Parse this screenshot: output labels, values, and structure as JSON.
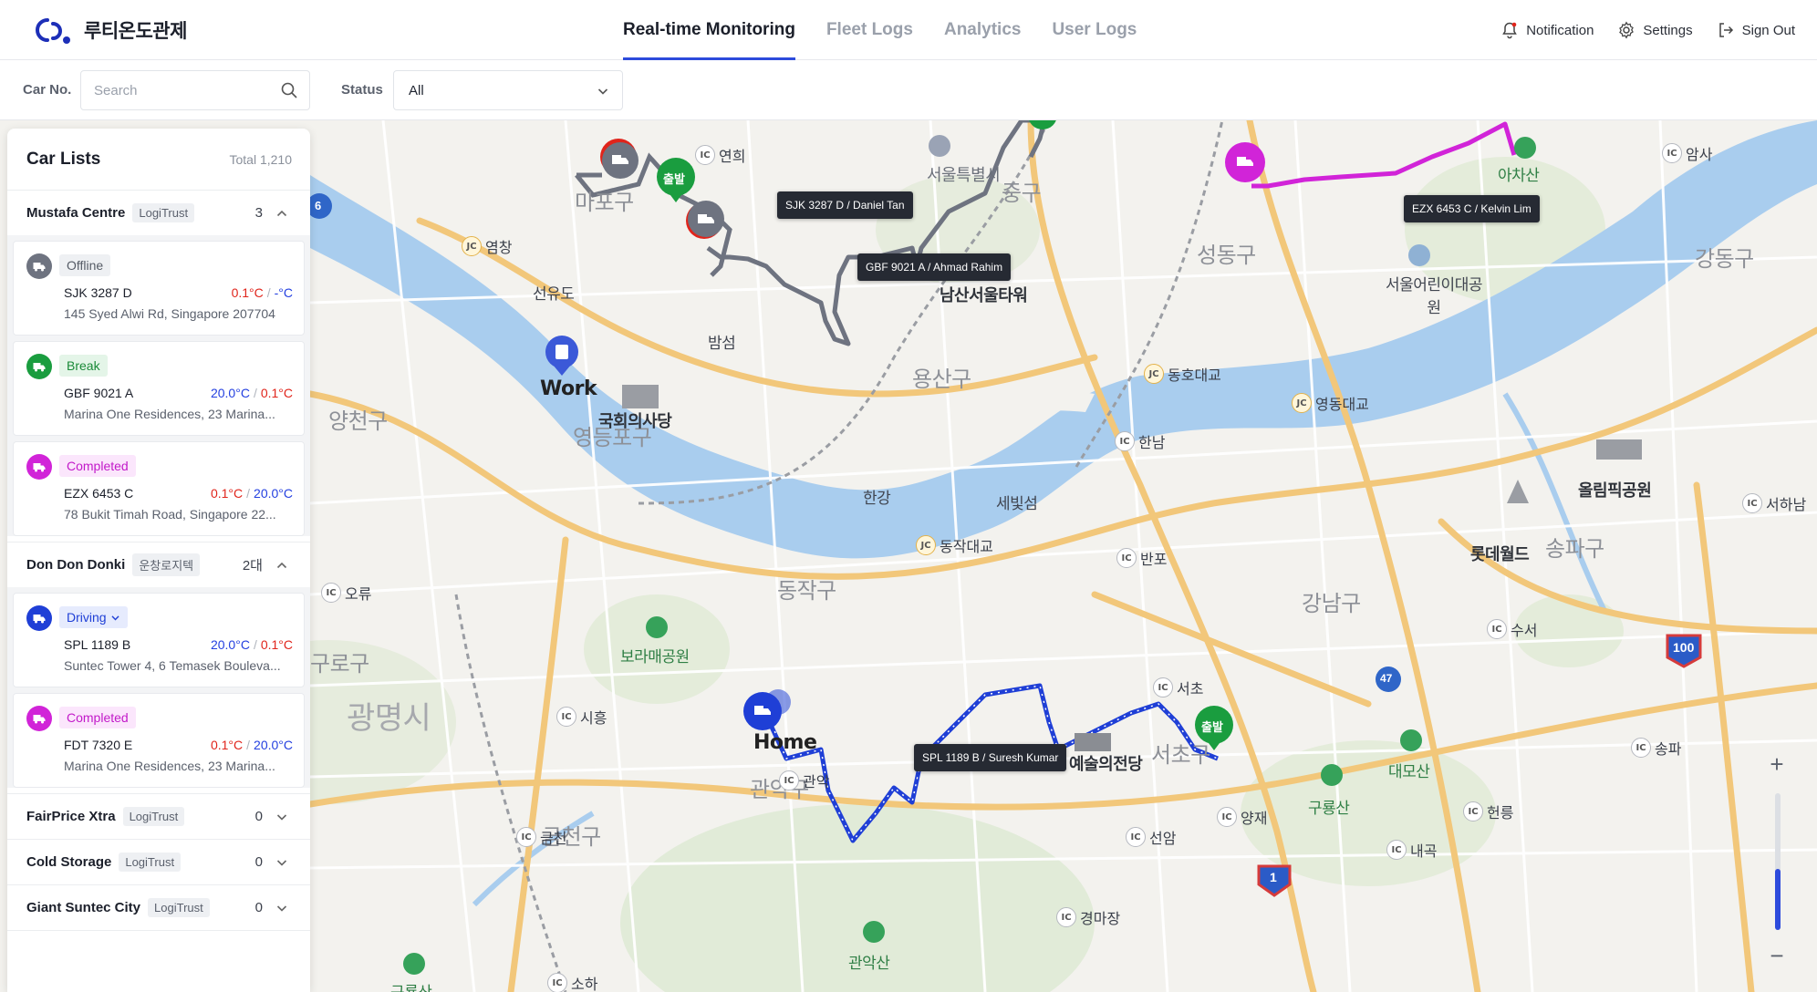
{
  "brand": {
    "name": "루티온도관제"
  },
  "nav": {
    "tabs": [
      {
        "label": "Real-time Monitoring"
      },
      {
        "label": "Fleet Logs"
      },
      {
        "label": "Analytics"
      },
      {
        "label": "User Logs"
      }
    ]
  },
  "header_actions": {
    "notification": "Notification",
    "settings": "Settings",
    "sign_out": "Sign Out"
  },
  "filters": {
    "car_no_label": "Car No.",
    "search_placeholder": "Search",
    "status_label": "Status",
    "status_value": "All"
  },
  "sidebar": {
    "title": "Car Lists",
    "total": "Total 1,210",
    "groups": [
      {
        "name": "Mustafa Centre",
        "tag": "LogiTrust",
        "count": "3",
        "cars": [
          {
            "status": "Offline",
            "plate": "SJK 3287 D",
            "temp1": "0.1°C",
            "temp2": "-°C",
            "address": "145 Syed Alwi Rd, Singapore 207704"
          },
          {
            "status": "Break",
            "plate": "GBF 9021 A",
            "temp1": "20.0°C",
            "temp2": "0.1°C",
            "address": "Marina One Residences, 23 Marina..."
          },
          {
            "status": "Completed",
            "plate": "EZX 6453 C",
            "temp1": "0.1°C",
            "temp2": "20.0°C",
            "address": "78 Bukit Timah Road, Singapore 22..."
          }
        ]
      },
      {
        "name": "Don Don Donki",
        "tag": "운창로지텍",
        "count": "2대",
        "cars": [
          {
            "status": "Driving",
            "plate": "SPL 1189 B",
            "temp1": "20.0°C",
            "temp2": "0.1°C",
            "address": "Suntec Tower 4, 6 Temasek Bouleva..."
          },
          {
            "status": "Completed",
            "plate": "FDT 7320 E",
            "temp1": "0.1°C",
            "temp2": "20.0°C",
            "address": "Marina One Residences, 23 Marina..."
          }
        ]
      },
      {
        "name": "FairPrice Xtra",
        "tag": "LogiTrust",
        "count": "0"
      },
      {
        "name": "Cold Storage",
        "tag": "LogiTrust",
        "count": "0"
      },
      {
        "name": "Giant Suntec City",
        "tag": "LogiTrust",
        "count": "0"
      }
    ]
  },
  "map": {
    "tooltips": {
      "t1": "SJK 3287 D / Daniel Tan",
      "t2": "GBF 9021 A / Ahmad Rahim",
      "t3": "EZX 6453 C / Kelvin Lim",
      "t4": "SPL 1189 B / Suresh Kumar"
    },
    "start_label": "출발",
    "pins": {
      "work": "Work",
      "home": "Home"
    },
    "districts": {
      "mapo": "마포구",
      "jung": "중구",
      "seongdong": "성동구",
      "gangdong": "강동구",
      "yongsan": "용산구",
      "yangcheon": "양천구",
      "yeongdeungpo": "영등포구",
      "dongjak": "동작구",
      "gangnam": "강남구",
      "songpa": "송파구",
      "guro": "구로구",
      "gwangmyeong": "광명시",
      "seocho": "서초구",
      "geumcheon": "금천구",
      "gwanak": "관악구",
      "seoulcity": "서울특별시"
    },
    "pois": {
      "namsan": "남산서울타워",
      "assembly": "국회의사당",
      "childpark": "서울어린이대공원",
      "olympic": "올림픽공원",
      "lotte": "롯데월드",
      "boramae": "보라매공원",
      "artcenter": "예술의전당",
      "achasan": "아차산",
      "daemosan": "대모산",
      "guryongsan": "구룡산",
      "gwanaksan": "관악산",
      "seonyudo": "선유도",
      "bamseom": "밤섬",
      "hangang": "한강",
      "sebitseom": "세빛섬",
      "guryongsan2": "구룡산"
    },
    "ics": {
      "yeonhui": "연희",
      "yeomchang": "염창",
      "dongho": "동호대교",
      "yeongdong": "영동대교",
      "hannam": "한남",
      "dongjak": "동작대교",
      "banpo": "반포",
      "seocho": "서초",
      "sisu": "수서",
      "amsa": "암사",
      "seohanam": "서하남",
      "ori": "오류",
      "siheung": "시흥",
      "yangjae": "양재",
      "heolleung": "헌릉",
      "songpa": "송파",
      "naegok": "내곡",
      "seonam": "선암",
      "gyeongmajang": "경마장",
      "geumcheon": "금천",
      "soha": "소하",
      "gwancheon": "관악"
    },
    "route_shields": {
      "r47": "47",
      "r100": "100",
      "r1": "1",
      "r6": "6"
    },
    "zoom_level": 0.45
  },
  "colors": {
    "accent": "#2d4bdc",
    "offline": "#6e7380",
    "break": "#1a9d3f",
    "completed": "#d124d8",
    "driving": "#1f3fd6",
    "red": "#e0241b"
  }
}
